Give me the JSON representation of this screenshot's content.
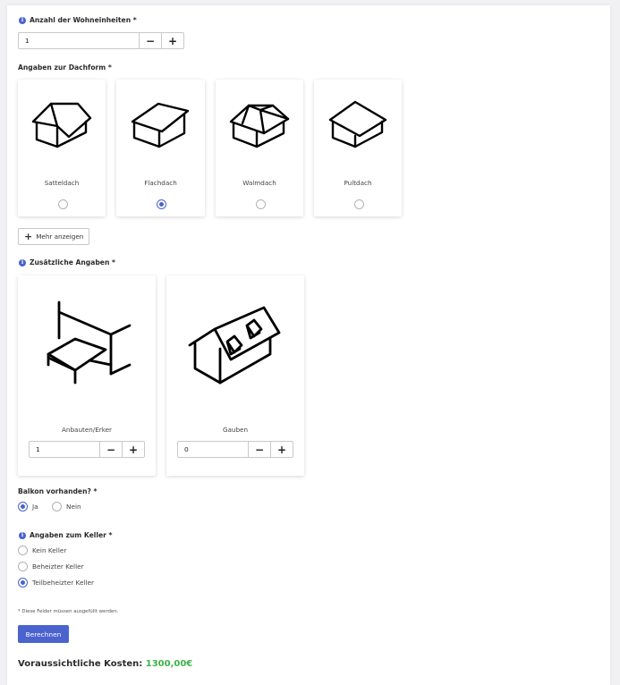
{
  "units": {
    "label": "Anzahl der Wohneinheiten *",
    "value": "1",
    "minus": "−",
    "plus": "+"
  },
  "roof": {
    "label": "Angaben zur Dachform *",
    "options": [
      {
        "name": "Satteldach",
        "icon": "gable-roof-icon",
        "selected": false
      },
      {
        "name": "Flachdach",
        "icon": "flat-roof-icon",
        "selected": true
      },
      {
        "name": "Walmdach",
        "icon": "hip-roof-icon",
        "selected": false
      },
      {
        "name": "Pultdach",
        "icon": "shed-roof-icon",
        "selected": false
      }
    ],
    "more_button": "Mehr anzeigen",
    "more_icon": "+"
  },
  "extras": {
    "label": "Zusätzliche Angaben *",
    "items": [
      {
        "name": "Anbauten/Erker",
        "icon": "annex-icon",
        "value": "1"
      },
      {
        "name": "Gauben",
        "icon": "dormer-icon",
        "value": "0"
      }
    ],
    "minus": "−",
    "plus": "+"
  },
  "balcony": {
    "label": "Balkon vorhanden? *",
    "options": [
      {
        "name": "Ja",
        "selected": true
      },
      {
        "name": "Nein",
        "selected": false
      }
    ]
  },
  "cellar": {
    "label": "Angaben zum Keller *",
    "options": [
      {
        "name": "Kein Keller",
        "selected": false
      },
      {
        "name": "Beheizter Keller",
        "selected": false
      },
      {
        "name": "Teilbeheizter Keller",
        "selected": true
      }
    ]
  },
  "required_note": "* Diese Felder müssen ausgefüllt werden.",
  "calculate_button": "Berechnen",
  "cost": {
    "label": "Voraussichtliche Kosten:",
    "amount": "1300,00€"
  },
  "colors": {
    "accent": "#4a63cf",
    "price": "#3bb34a"
  },
  "info_icon": "i"
}
